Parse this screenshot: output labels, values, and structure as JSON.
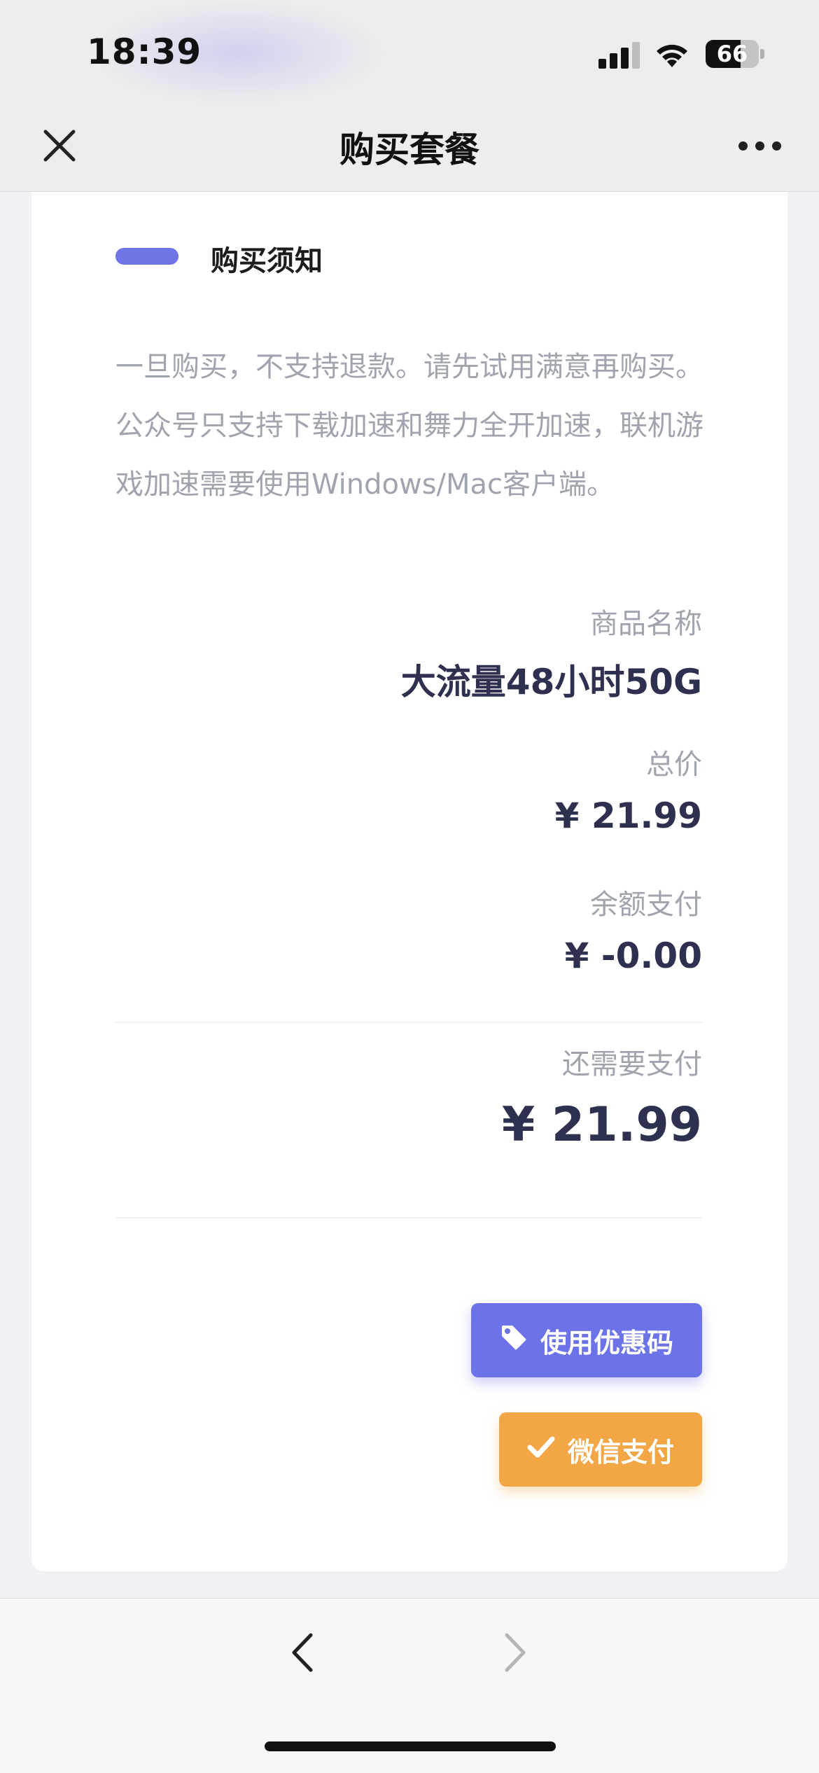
{
  "status_bar": {
    "time": "18:39",
    "battery_percent": "66",
    "battery_level": 0.66,
    "icons": [
      "signal-icon",
      "wifi-icon",
      "battery-icon"
    ]
  },
  "nav": {
    "title": "购买套餐",
    "close_icon": "close-icon",
    "more_icon": "more-icon"
  },
  "notice": {
    "title": "购买须知",
    "lines": [
      "一旦购买，不支持退款。请先试用满意再购买。",
      "公众号只支持下载加速和舞力全开加速，联机游戏加速需要使用Windows/Mac客户端。"
    ]
  },
  "order": {
    "product_label": "商品名称",
    "product_value": "大流量48小时50G",
    "total_label": "总价",
    "total_value": "¥ 21.99",
    "balance_label": "余额支付",
    "balance_value": "¥ -0.00",
    "due_label": "还需要支付",
    "due_value": "¥ 21.99"
  },
  "actions": {
    "coupon_label": "使用优惠码",
    "pay_label": "微信支付"
  },
  "colors": {
    "accent": "#6c73e8",
    "pay": "#f3a646",
    "value_text": "#2e3050",
    "muted_text": "#a0a4ae"
  }
}
